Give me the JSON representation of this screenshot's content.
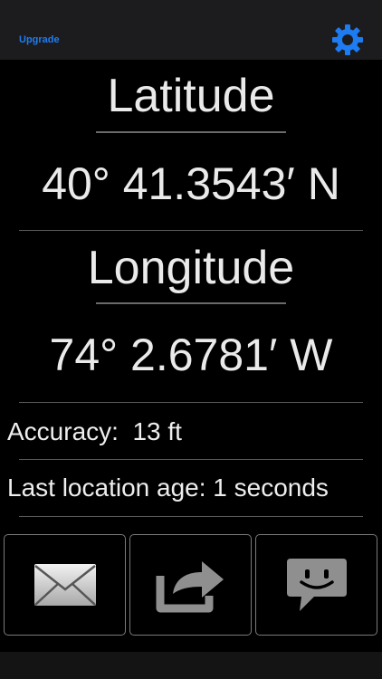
{
  "topbar": {
    "upgrade_label": "Upgrade",
    "settings_icon": "gear-icon",
    "accent_color": "#1e7cf2"
  },
  "latitude": {
    "heading": "Latitude",
    "value": "40° 41.3543′ N"
  },
  "longitude": {
    "heading": "Longitude",
    "value": "74° 2.6781′ W"
  },
  "accuracy": {
    "text": "Accuracy:  13 ft"
  },
  "location_age": {
    "text": "Last location age: 1 seconds"
  },
  "actions": [
    {
      "icon": "envelope-icon"
    },
    {
      "icon": "share-arrow-icon"
    },
    {
      "icon": "chat-bubble-icon"
    }
  ]
}
